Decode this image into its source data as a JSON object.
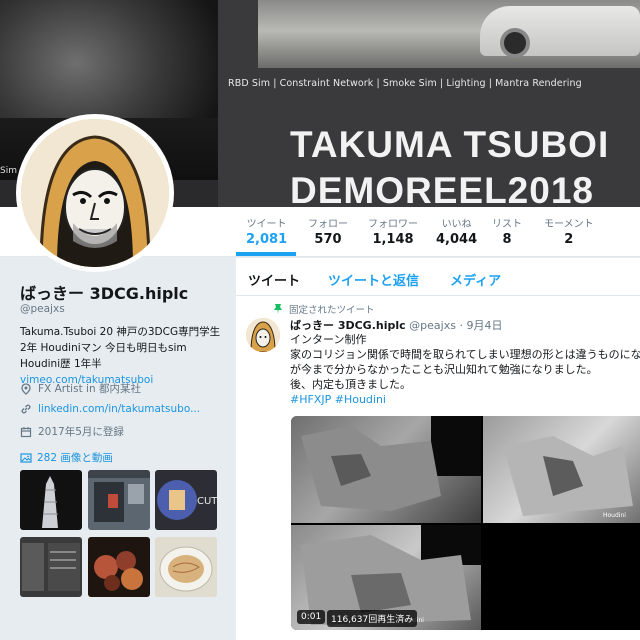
{
  "banner": {
    "caption": "RBD Sim | Constraint Network | Smoke Sim | Lighting | Mantra Rendering",
    "title_line1": "TAKUMA TSUBOI",
    "title_line2": "DEMOREEL2018",
    "left_fragment": "Sim |"
  },
  "stats": [
    {
      "label": "ツイート",
      "value": "2,081",
      "active": true
    },
    {
      "label": "フォロー",
      "value": "570"
    },
    {
      "label": "フォロワー",
      "value": "1,148"
    },
    {
      "label": "いいね",
      "value": "4,044"
    },
    {
      "label": "リスト",
      "value": "8"
    },
    {
      "label": "モーメント",
      "value": "2"
    }
  ],
  "profile": {
    "name": "ばっきー 3DCG.hiplc",
    "handle": "@peajxs",
    "bio_line1": "Takuma.Tsuboi 20 神戸の3DCG専門学生",
    "bio_line2": "2年 Houdiniマン 今日も明日もsim",
    "bio_line3_prefix": "Houdini歴 1年半 ",
    "bio_link": "vimeo.com/takumatsuboi",
    "location": "FX Artist in 都内某社",
    "website": "linkedin.com/in/takumatsubo...",
    "joined": "2017年5月に登録",
    "media_label": "282 画像と動画"
  },
  "tabs": [
    "ツイート",
    "ツイートと返信",
    "メディア"
  ],
  "tweet": {
    "pinned_label": "固定されたツイート",
    "name": "ばっきー 3DCG.hiplc",
    "handle": "@peajxs",
    "date": "· 9月4日",
    "line1": "インターン制作",
    "line2": "家のコリジョン関係で時間を取られてしまい理想の形とは違うものになり",
    "line3": "が今まで分からなかったことも沢山知れて勉強になりました。",
    "line4": "後、内定も頂きました。",
    "hashtags": "#HFXJP #Houdini",
    "video_time": "0:01",
    "video_views": "116,637回再生済み",
    "video_watermark": "Houdini"
  },
  "thumb_text": "CUT",
  "colors": {
    "accent": "#1da1f2",
    "link": "#1b95e0",
    "muted": "#657786",
    "bg": "#e6ecf0"
  }
}
